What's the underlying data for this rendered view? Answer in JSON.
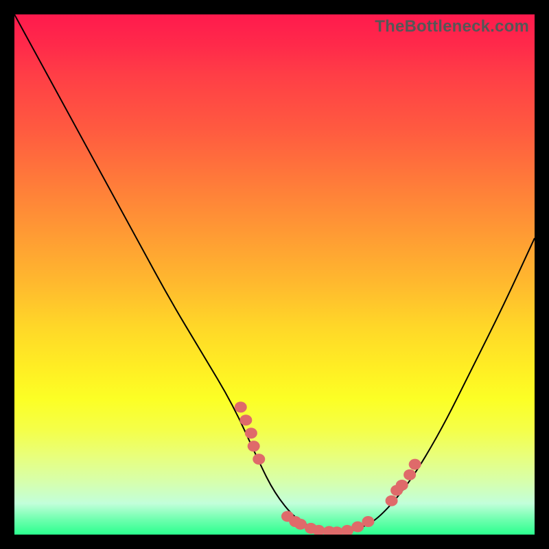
{
  "watermark": "TheBottleneck.com",
  "colors": {
    "frame": "#000000",
    "curve": "#000000",
    "dot": "#df6a6a",
    "gradient_top": "#ff1a4d",
    "gradient_bottom": "#2bff8e"
  },
  "chart_data": {
    "type": "line",
    "title": "",
    "xlabel": "",
    "ylabel": "",
    "xlim": [
      0,
      100
    ],
    "ylim": [
      0,
      100
    ],
    "series": [
      {
        "name": "bottleneck-curve",
        "x": [
          0,
          6,
          12,
          18,
          24,
          30,
          36,
          42,
          47,
          50,
          54,
          58,
          62,
          66,
          70,
          76,
          82,
          88,
          94,
          100
        ],
        "y": [
          100,
          89,
          78,
          67,
          56,
          45,
          35,
          25,
          14,
          8,
          3,
          1,
          0,
          1,
          3,
          10,
          20,
          32,
          44,
          57
        ]
      }
    ],
    "markers": {
      "name": "highlight-dots",
      "comment": "Scatter markers clustered along curve near trough",
      "points": [
        {
          "x": 43.5,
          "y": 24.5
        },
        {
          "x": 44.5,
          "y": 22.0
        },
        {
          "x": 45.5,
          "y": 19.5
        },
        {
          "x": 46.0,
          "y": 17.0
        },
        {
          "x": 47.0,
          "y": 14.5
        },
        {
          "x": 52.5,
          "y": 3.5
        },
        {
          "x": 54.0,
          "y": 2.5
        },
        {
          "x": 55.0,
          "y": 2.0
        },
        {
          "x": 57.0,
          "y": 1.2
        },
        {
          "x": 58.5,
          "y": 0.8
        },
        {
          "x": 60.5,
          "y": 0.6
        },
        {
          "x": 62.0,
          "y": 0.5
        },
        {
          "x": 64.0,
          "y": 0.8
        },
        {
          "x": 66.0,
          "y": 1.5
        },
        {
          "x": 68.0,
          "y": 2.5
        },
        {
          "x": 72.5,
          "y": 6.5
        },
        {
          "x": 73.5,
          "y": 8.5
        },
        {
          "x": 74.5,
          "y": 9.5
        },
        {
          "x": 76.0,
          "y": 11.5
        },
        {
          "x": 77.0,
          "y": 13.5
        }
      ]
    }
  }
}
